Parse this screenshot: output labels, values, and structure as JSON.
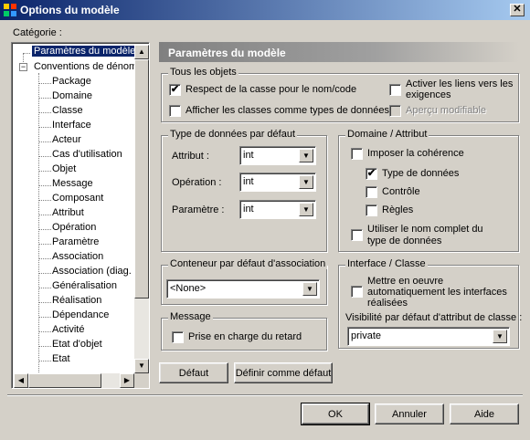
{
  "window": {
    "title": "Options du modèle",
    "close_glyph": "✕"
  },
  "category": {
    "label": "Catégorie :"
  },
  "tree": {
    "root_selected": "Paramètres du modèle",
    "conventions": "Conventions de dénom",
    "children": [
      "Package",
      "Domaine",
      "Classe",
      "Interface",
      "Acteur",
      "Cas d'utilisation",
      "Objet",
      "Message",
      "Composant",
      "Attribut",
      "Opération",
      "Paramètre",
      "Association",
      "Association (diag. c",
      "Généralisation",
      "Réalisation",
      "Dépendance",
      "Activité",
      "Etat d'objet",
      "Etat"
    ]
  },
  "panel": {
    "title": "Paramètres du modèle"
  },
  "tous_objets": {
    "legend": "Tous les objets",
    "respect_casse": {
      "label": "Respect de la casse pour le nom/code",
      "checked": true
    },
    "afficher_classes": {
      "label": "Afficher les classes comme types de données",
      "checked": false
    },
    "activer_liens": {
      "label_l1": "Activer les liens vers les",
      "label_l2": "exigences",
      "checked": false
    },
    "apercu": {
      "label": "Aperçu modifiable",
      "checked": false,
      "disabled": true
    }
  },
  "type_defaut": {
    "legend": "Type de données par défaut",
    "attribut": {
      "label": "Attribut :",
      "value": "int"
    },
    "operation": {
      "label": "Opération :",
      "value": "int"
    },
    "parametre": {
      "label": "Paramètre :",
      "value": "int"
    }
  },
  "domaine_attr": {
    "legend": "Domaine / Attribut",
    "imposer": {
      "label": "Imposer la cohérence",
      "checked": false
    },
    "type_donnees": {
      "label": "Type de données",
      "checked": true
    },
    "controle": {
      "label": "Contrôle",
      "checked": false
    },
    "regles": {
      "label": "Règles",
      "checked": false
    },
    "nom_complet": {
      "label_l1": "Utiliser le nom complet du",
      "label_l2": "type de données",
      "checked": false
    }
  },
  "conteneur": {
    "legend": "Conteneur par défaut d'association",
    "value": "<None>"
  },
  "interface_classe": {
    "legend": "Interface / Classe",
    "mettre_oeuvre": {
      "label_l1": "Mettre en oeuvre",
      "label_l2": "automatiquement les interfaces",
      "label_l3": "réalisées",
      "checked": false
    },
    "visibilite_label": "Visibilité par défaut d'attribut de classe :",
    "visibilite_value": "private"
  },
  "message": {
    "legend": "Message",
    "retard": {
      "label": "Prise en charge du retard",
      "checked": false
    }
  },
  "buttons": {
    "defaut": "Défaut",
    "definir": "Définir comme défaut",
    "ok": "OK",
    "annuler": "Annuler",
    "aide": "Aide"
  },
  "glyphs": {
    "check": "✔",
    "arrow_down": "▼",
    "arrow_up": "▲",
    "arrow_left": "◀",
    "arrow_right": "▶",
    "minus": "−",
    "plus": "+"
  }
}
